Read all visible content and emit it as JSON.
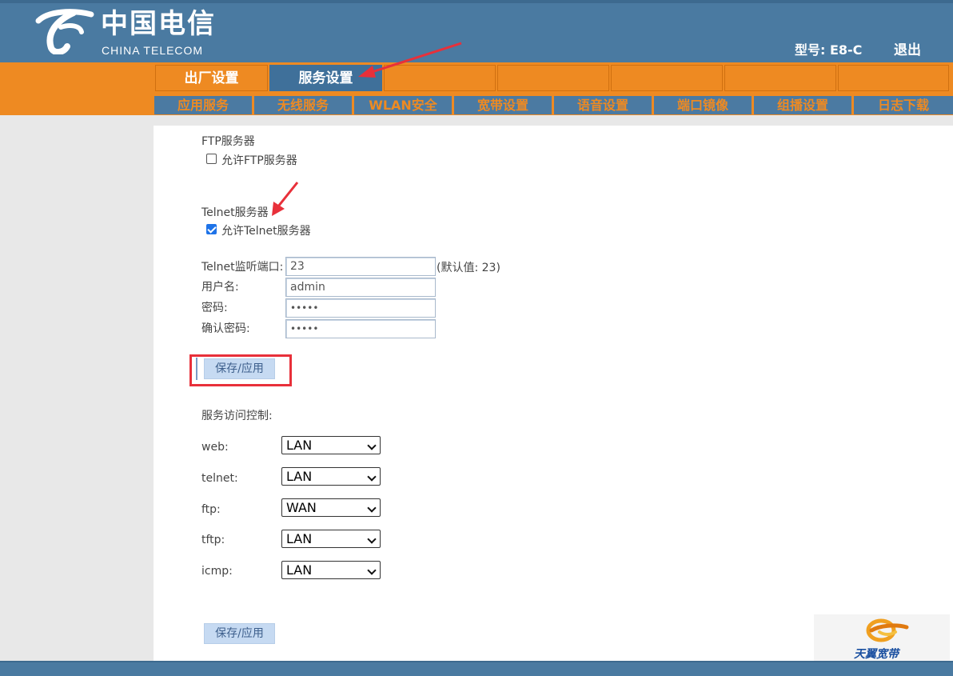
{
  "header": {
    "brand_cn": "中国电信",
    "brand_en": "CHINA TELECOM",
    "model": "型号: E8-C",
    "logout": "退出"
  },
  "top_tabs": [
    "出厂设置",
    "服务设置",
    "",
    "",
    "",
    "",
    ""
  ],
  "top_tabs_active": 1,
  "sub_tabs": [
    "应用服务",
    "无线服务",
    "WLAN安全",
    "宽带设置",
    "语音设置",
    "端口镜像",
    "组播设置",
    "日志下载"
  ],
  "ftp": {
    "title": "FTP服务器",
    "checkbox_label": "允许FTP服务器",
    "checked": false
  },
  "telnet": {
    "title": "Telnet服务器",
    "checkbox_label": "允许Telnet服务器",
    "checked": true,
    "port_label": "Telnet监听端口:",
    "port_value": "23",
    "port_hint": "(默认值: 23)",
    "user_label": "用户名:",
    "user_value": "admin",
    "pass_label": "密码:",
    "pass_value": "•••••",
    "confirm_label": "确认密码:",
    "confirm_value": "•••••"
  },
  "save_label": "保存/应用",
  "access_control": {
    "title": "服务访问控制:",
    "rows": [
      {
        "label": "web:",
        "value": "LAN"
      },
      {
        "label": "telnet:",
        "value": "LAN"
      },
      {
        "label": "ftp:",
        "value": "WAN"
      },
      {
        "label": "tftp:",
        "value": "LAN"
      },
      {
        "label": "icmp:",
        "value": "LAN"
      }
    ]
  },
  "corner_logo": "天翼宽带",
  "colors": {
    "header_blue": "#4a7aa1",
    "orange": "#ee8a22",
    "annotation_red": "#e8303a"
  }
}
